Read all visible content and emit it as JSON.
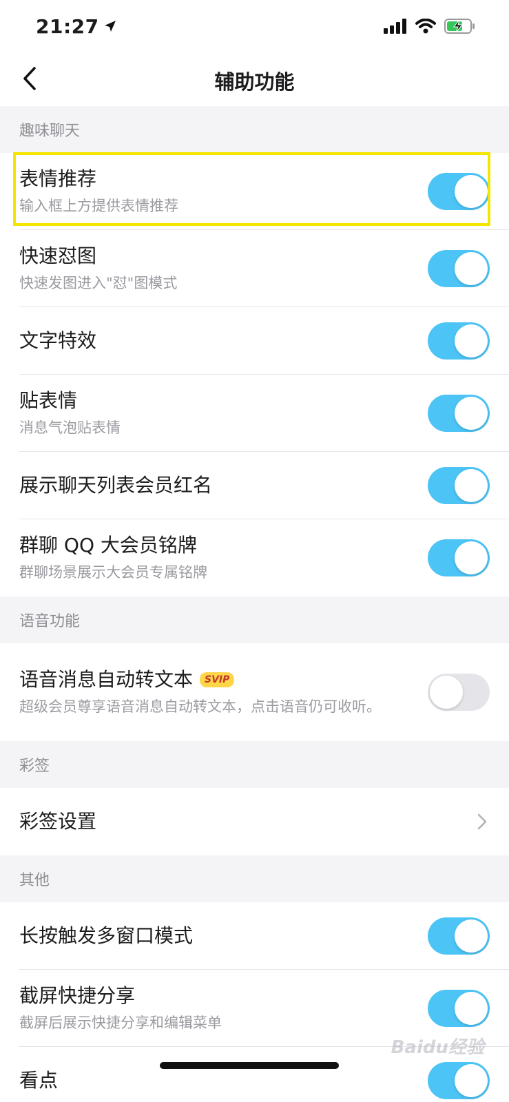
{
  "status_bar": {
    "time": "21:27",
    "location_icon": "location-arrow-icon",
    "signal_icon": "signal-bars-icon",
    "wifi_icon": "wifi-icon",
    "battery_icon": "battery-charging-icon",
    "battery_color": "#34c759"
  },
  "nav": {
    "back_icon": "chevron-left-icon",
    "title": "辅助功能"
  },
  "sections": {
    "fun_chat": {
      "header": "趣味聊天",
      "items": [
        {
          "title": "表情推荐",
          "subtitle": "输入框上方提供表情推荐",
          "toggle": "on"
        },
        {
          "title": "快速怼图",
          "subtitle": "快速发图进入\"怼\"图模式",
          "toggle": "on"
        },
        {
          "title": "文字特效",
          "subtitle": "",
          "toggle": "on"
        },
        {
          "title": "贴表情",
          "subtitle": "消息气泡贴表情",
          "toggle": "on"
        },
        {
          "title": "展示聊天列表会员红名",
          "subtitle": "",
          "toggle": "on"
        },
        {
          "title": "群聊 QQ 大会员铭牌",
          "subtitle": "群聊场景展示大会员专属铭牌",
          "toggle": "on"
        }
      ]
    },
    "voice": {
      "header": "语音功能",
      "items": [
        {
          "title": "语音消息自动转文本",
          "badge": "SVIP",
          "subtitle": "超级会员尊享语音消息自动转文本，点击语音仍可收听。",
          "toggle": "off"
        }
      ]
    },
    "color_sign": {
      "header": "彩签",
      "items": [
        {
          "title": "彩签设置",
          "chevron_icon": "chevron-right-icon"
        }
      ]
    },
    "other": {
      "header": "其他",
      "items": [
        {
          "title": "长按触发多窗口模式",
          "subtitle": "",
          "toggle": "on"
        },
        {
          "title": "截屏快捷分享",
          "subtitle": "截屏后展示快捷分享和编辑菜单",
          "toggle": "on"
        },
        {
          "title": "看点",
          "subtitle": "",
          "toggle": "on"
        }
      ]
    }
  },
  "colors": {
    "toggle_on": "#4cc4f6",
    "toggle_off": "#e4e4e9",
    "highlight_border": "#f5e600",
    "svip_badge_bg": "#ffd54a",
    "svip_badge_text": "#c0392b"
  },
  "watermark": "Baidu经验"
}
